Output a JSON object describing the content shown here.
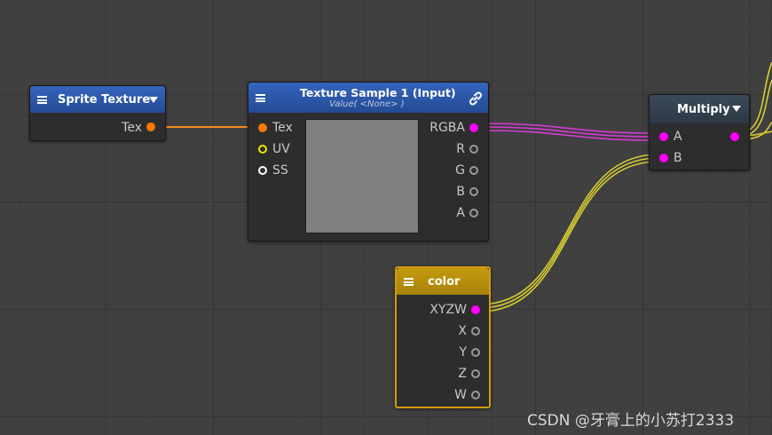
{
  "wire_colors": {
    "orange": "#f28c1e",
    "magenta": "#d23cd2",
    "yellow": "#d7cb32"
  },
  "nodes": {
    "sprite_texture": {
      "title": "Sprite Texture",
      "header_color": "#2c57a8",
      "output": "Tex"
    },
    "texture_sample": {
      "title": "Texture Sample 1 (Input)",
      "subtitle": "Value( <None> )",
      "header_color": "#2c57a8",
      "inputs": [
        "Tex",
        "UV",
        "SS"
      ],
      "outputs": [
        "RGBA",
        "R",
        "G",
        "B",
        "A"
      ],
      "preview_color": "#808080"
    },
    "multiply": {
      "title": "Multiply",
      "header_color": "#34414f",
      "inputs": [
        "A",
        "B"
      ]
    },
    "color": {
      "title": "color",
      "header_color": "#b28d0c",
      "outputs": [
        "XYZW",
        "X",
        "Y",
        "Z",
        "W"
      ]
    }
  },
  "watermark": "CSDN @牙膏上的小苏打2333"
}
